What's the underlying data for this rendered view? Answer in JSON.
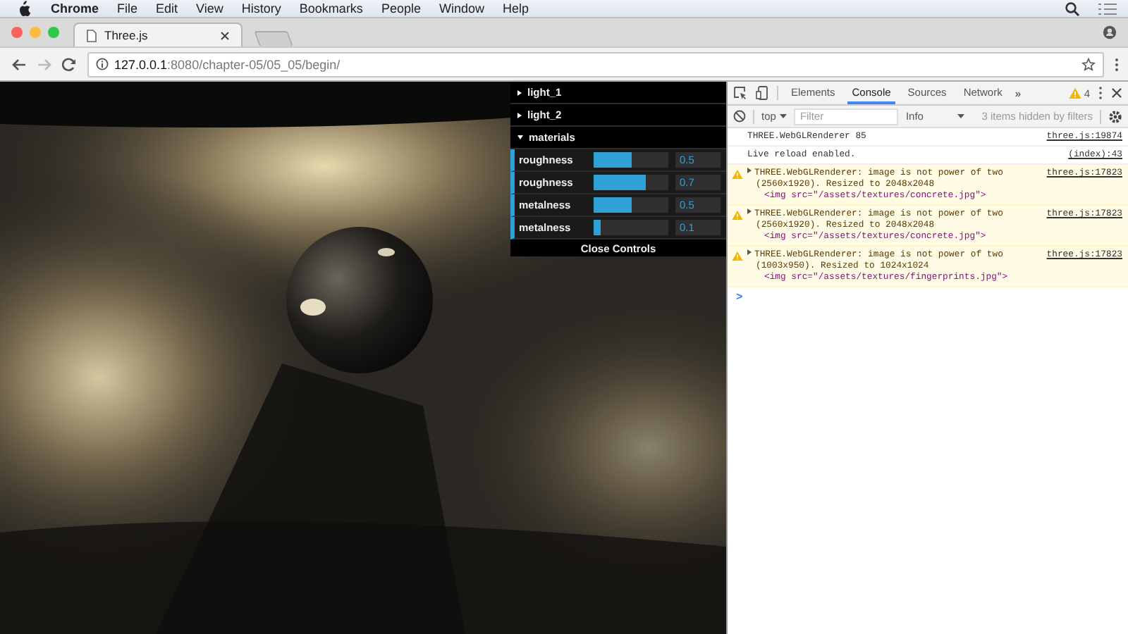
{
  "menu_bar": {
    "app": "Chrome",
    "items": [
      "File",
      "Edit",
      "View",
      "History",
      "Bookmarks",
      "People",
      "Window",
      "Help"
    ]
  },
  "browser": {
    "tab": {
      "title": "Three.js"
    },
    "address": {
      "host": "127.0.0.1",
      "path": ":8080/chapter-05/05_05/begin/"
    }
  },
  "controls": {
    "folders": [
      {
        "label": "light_1",
        "expanded": false
      },
      {
        "label": "light_2",
        "expanded": false
      },
      {
        "label": "materials",
        "expanded": true,
        "controllers": [
          {
            "label": "roughness",
            "level": 0.5,
            "value": "0.5"
          },
          {
            "label": "roughness",
            "level": 0.7,
            "value": "0.7"
          },
          {
            "label": "metalness",
            "level": 0.5,
            "value": "0.5"
          },
          {
            "label": "metalness",
            "level": 0.1,
            "value": "0.1"
          }
        ]
      }
    ],
    "close_button": "Close Controls"
  },
  "devtools": {
    "tabs": [
      {
        "label": "Elements",
        "selected": false
      },
      {
        "label": "Console",
        "selected": true
      },
      {
        "label": "Sources",
        "selected": false
      },
      {
        "label": "Network",
        "selected": false
      }
    ],
    "overflow": "»",
    "warning_count": "4",
    "toolbar": {
      "context": "top",
      "filter_placeholder": "Filter",
      "level": "Info",
      "hidden_note": "3 items hidden by filters"
    },
    "messages": [
      {
        "kind": "log",
        "text": "THREE.WebGLRenderer 85",
        "source": "three.js:19874"
      },
      {
        "kind": "log",
        "text": "Live reload enabled.",
        "source": "(index):43"
      },
      {
        "kind": "warning",
        "text": "THREE.WebGLRenderer: image is not power of two (2560x1920). Resized to 2048x2048",
        "element": "<img src=\"/assets/textures/concrete.jpg\">",
        "source": "three.js:17823"
      },
      {
        "kind": "warning",
        "text": "THREE.WebGLRenderer: image is not power of two (2560x1920). Resized to 2048x2048",
        "element": "<img src=\"/assets/textures/concrete.jpg\">",
        "source": "three.js:17823"
      },
      {
        "kind": "warning",
        "text": "THREE.WebGLRenderer: image is not power of two (1003x950). Resized to 1024x1024",
        "element": "<img src=\"/assets/textures/fingerprints.jpg\">",
        "source": "three.js:17823"
      }
    ],
    "prompt": ">"
  }
}
